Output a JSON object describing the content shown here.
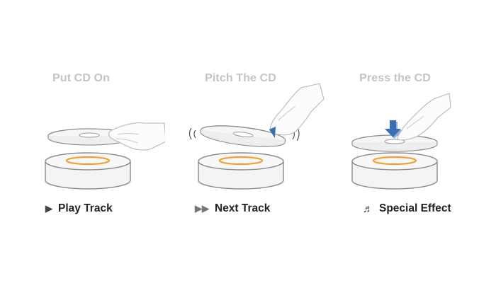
{
  "steps": [
    {
      "heading": "Put CD On",
      "caption": "Play Track",
      "icon": "play-icon",
      "icon_glyph": "▶"
    },
    {
      "heading": "Pitch The CD",
      "caption": "Next Track",
      "icon": "fast-forward-icon",
      "icon_glyph": "▶▶"
    },
    {
      "heading": "Press the CD",
      "caption": "Special Effect",
      "icon": "music-note-icon",
      "icon_glyph": "♬"
    }
  ],
  "colors": {
    "heading": "#c4c4c4",
    "caption": "#222222",
    "outline": "#8a8a8a",
    "ring": "#f0a030",
    "arrow": "#3a6fb5"
  }
}
